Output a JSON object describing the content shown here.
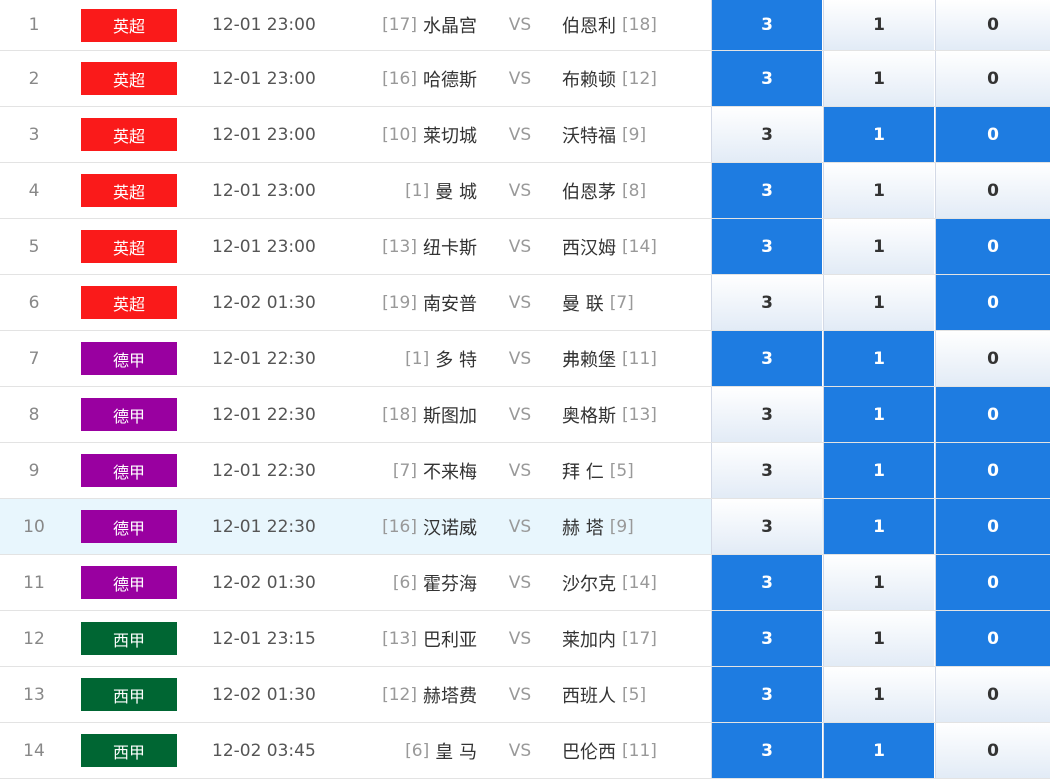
{
  "colors": {
    "league_epl": "#fa1a1a",
    "league_bundesliga": "#9900a0",
    "league_laliga": "#006633",
    "selected_odds": "#1e7ce1",
    "row_highlight": "#e8f6fd"
  },
  "matches": [
    {
      "no": "1",
      "league": "英超",
      "league_color": "#fa1a1a",
      "time": "12-01 23:00",
      "home_rank": "[17]",
      "home": "水晶宫",
      "vs": "VS",
      "away": "伯恩利",
      "away_rank": "[18]",
      "odds": [
        "3",
        "1",
        "0"
      ],
      "selected": [
        true,
        false,
        false
      ],
      "highlight": false
    },
    {
      "no": "2",
      "league": "英超",
      "league_color": "#fa1a1a",
      "time": "12-01 23:00",
      "home_rank": "[16]",
      "home": "哈德斯",
      "vs": "VS",
      "away": "布赖顿",
      "away_rank": "[12]",
      "odds": [
        "3",
        "1",
        "0"
      ],
      "selected": [
        true,
        false,
        false
      ],
      "highlight": false
    },
    {
      "no": "3",
      "league": "英超",
      "league_color": "#fa1a1a",
      "time": "12-01 23:00",
      "home_rank": "[10]",
      "home": "莱切城",
      "vs": "VS",
      "away": "沃特福",
      "away_rank": "[9]",
      "odds": [
        "3",
        "1",
        "0"
      ],
      "selected": [
        false,
        true,
        true
      ],
      "highlight": false
    },
    {
      "no": "4",
      "league": "英超",
      "league_color": "#fa1a1a",
      "time": "12-01 23:00",
      "home_rank": "[1]",
      "home": "曼 城",
      "vs": "VS",
      "away": "伯恩茅",
      "away_rank": "[8]",
      "odds": [
        "3",
        "1",
        "0"
      ],
      "selected": [
        true,
        false,
        false
      ],
      "highlight": false
    },
    {
      "no": "5",
      "league": "英超",
      "league_color": "#fa1a1a",
      "time": "12-01 23:00",
      "home_rank": "[13]",
      "home": "纽卡斯",
      "vs": "VS",
      "away": "西汉姆",
      "away_rank": "[14]",
      "odds": [
        "3",
        "1",
        "0"
      ],
      "selected": [
        true,
        false,
        true
      ],
      "highlight": false
    },
    {
      "no": "6",
      "league": "英超",
      "league_color": "#fa1a1a",
      "time": "12-02 01:30",
      "home_rank": "[19]",
      "home": "南安普",
      "vs": "VS",
      "away": "曼 联",
      "away_rank": "[7]",
      "odds": [
        "3",
        "1",
        "0"
      ],
      "selected": [
        false,
        false,
        true
      ],
      "highlight": false
    },
    {
      "no": "7",
      "league": "德甲",
      "league_color": "#9900a0",
      "time": "12-01 22:30",
      "home_rank": "[1]",
      "home": "多 特",
      "vs": "VS",
      "away": "弗赖堡",
      "away_rank": "[11]",
      "odds": [
        "3",
        "1",
        "0"
      ],
      "selected": [
        true,
        true,
        false
      ],
      "highlight": false
    },
    {
      "no": "8",
      "league": "德甲",
      "league_color": "#9900a0",
      "time": "12-01 22:30",
      "home_rank": "[18]",
      "home": "斯图加",
      "vs": "VS",
      "away": "奥格斯",
      "away_rank": "[13]",
      "odds": [
        "3",
        "1",
        "0"
      ],
      "selected": [
        false,
        true,
        true
      ],
      "highlight": false
    },
    {
      "no": "9",
      "league": "德甲",
      "league_color": "#9900a0",
      "time": "12-01 22:30",
      "home_rank": "[7]",
      "home": "不来梅",
      "vs": "VS",
      "away": "拜 仁",
      "away_rank": "[5]",
      "odds": [
        "3",
        "1",
        "0"
      ],
      "selected": [
        false,
        true,
        true
      ],
      "highlight": false
    },
    {
      "no": "10",
      "league": "德甲",
      "league_color": "#9900a0",
      "time": "12-01 22:30",
      "home_rank": "[16]",
      "home": "汉诺威",
      "vs": "VS",
      "away": "赫 塔",
      "away_rank": "[9]",
      "odds": [
        "3",
        "1",
        "0"
      ],
      "selected": [
        false,
        true,
        true
      ],
      "highlight": true
    },
    {
      "no": "11",
      "league": "德甲",
      "league_color": "#9900a0",
      "time": "12-02 01:30",
      "home_rank": "[6]",
      "home": "霍芬海",
      "vs": "VS",
      "away": "沙尔克",
      "away_rank": "[14]",
      "odds": [
        "3",
        "1",
        "0"
      ],
      "selected": [
        true,
        false,
        true
      ],
      "highlight": false
    },
    {
      "no": "12",
      "league": "西甲",
      "league_color": "#006633",
      "time": "12-01 23:15",
      "home_rank": "[13]",
      "home": "巴利亚",
      "vs": "VS",
      "away": "莱加内",
      "away_rank": "[17]",
      "odds": [
        "3",
        "1",
        "0"
      ],
      "selected": [
        true,
        false,
        true
      ],
      "highlight": false
    },
    {
      "no": "13",
      "league": "西甲",
      "league_color": "#006633",
      "time": "12-02 01:30",
      "home_rank": "[12]",
      "home": "赫塔费",
      "vs": "VS",
      "away": "西班人",
      "away_rank": "[5]",
      "odds": [
        "3",
        "1",
        "0"
      ],
      "selected": [
        true,
        false,
        false
      ],
      "highlight": false
    },
    {
      "no": "14",
      "league": "西甲",
      "league_color": "#006633",
      "time": "12-02 03:45",
      "home_rank": "[6]",
      "home": "皇 马",
      "vs": "VS",
      "away": "巴伦西",
      "away_rank": "[11]",
      "odds": [
        "3",
        "1",
        "0"
      ],
      "selected": [
        true,
        true,
        false
      ],
      "highlight": false
    }
  ]
}
